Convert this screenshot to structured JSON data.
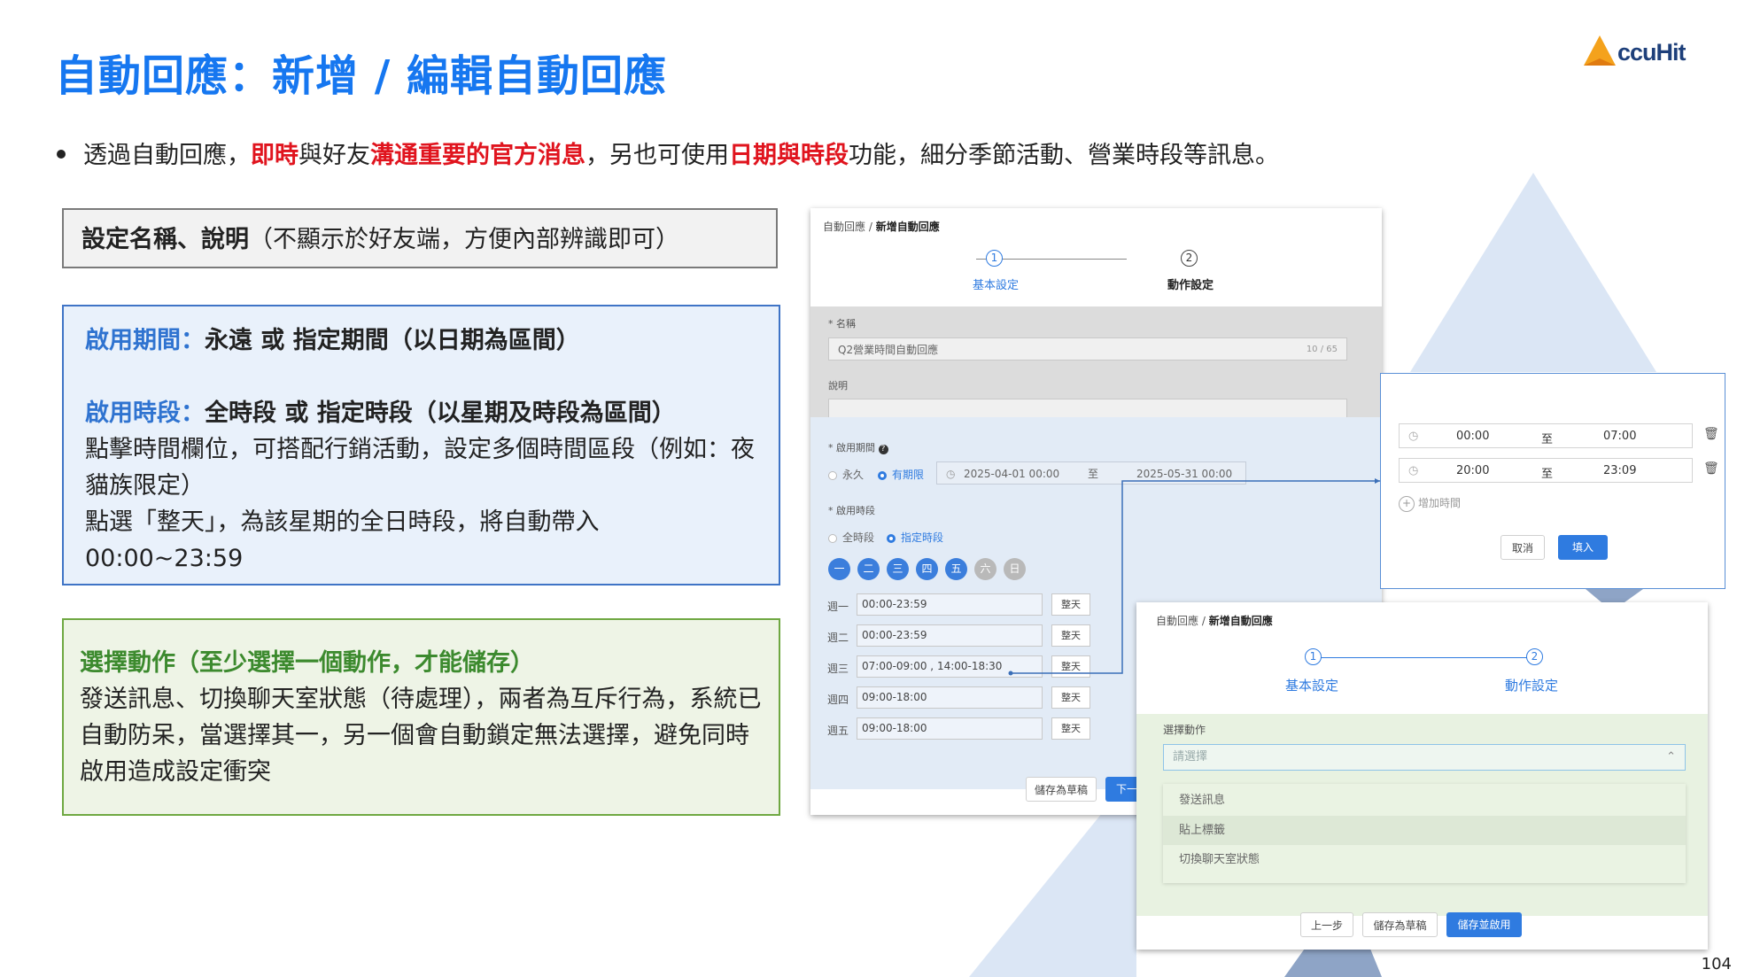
{
  "slide": {
    "title": "自動回應：新增 / 編輯自動回應",
    "logo_text": "ccuHit",
    "page_number": "104",
    "bullet": {
      "p1": "透過自動回應，",
      "r1": "即時",
      "p2": "與好友",
      "r2": "溝通重要的官方消息",
      "p3": "，另也可使用",
      "r3": "日期與時段",
      "p4": "功能，細分季節活動、營業時段等訊息。"
    }
  },
  "box1": {
    "bold": "設定名稱、說明",
    "rest": "（不顯示於好友端，方便內部辨識即可）"
  },
  "box2": {
    "l1_label": "啟用期間：",
    "l1_value": "永遠 或 指定期間（以日期為區間）",
    "l2_label": "啟用時段：",
    "l2_value": "全時段 或 指定時段（以星期及時段為區間）",
    "l3": "點擊時間欄位，可搭配行銷活動，設定多個時間區段（例如：夜貓族限定）",
    "l4": "點選「整天」，為該星期的全日時段，將自動帶入 00:00~23:59"
  },
  "box3": {
    "label": "選擇動作（至少選擇一個動作，才能儲存）",
    "text": "發送訊息、切換聊天室狀態（待處理），兩者為互斥行為，系統已自動防呆，當選擇其一，另一個會自動鎖定無法選擇，避免同時啟用造成設定衝突"
  },
  "shot1": {
    "crumb_root": "自動回應",
    "crumb_sep": "/",
    "crumb_current": "新增自動回應",
    "step1_num": "1",
    "step1_label": "基本設定",
    "step2_num": "2",
    "step2_label": "動作設定",
    "name_label": "* 名稱",
    "name_value": "Q2營業時間自動回應",
    "name_count": "10 / 65",
    "desc_label": "說明",
    "period_label": "* 啟用期間",
    "period_forever": "永久",
    "period_limited": "有期限",
    "date_start": "2025-04-01 00:00",
    "date_to": "至",
    "date_end": "2025-05-31 00:00",
    "slot_label": "* 啟用時段",
    "slot_all": "全時段",
    "slot_specific": "指定時段",
    "days": [
      "一",
      "二",
      "三",
      "四",
      "五",
      "六",
      "日"
    ],
    "weeks": [
      {
        "label": "週一",
        "value": "00:00-23:59",
        "btn": "整天"
      },
      {
        "label": "週二",
        "value": "00:00-23:59",
        "btn": "整天"
      },
      {
        "label": "週三",
        "value": "07:00-09:00 , 14:00-18:30",
        "btn": "整天"
      },
      {
        "label": "週四",
        "value": "09:00-18:00",
        "btn": "整天"
      },
      {
        "label": "週五",
        "value": "09:00-18:00",
        "btn": "整天"
      }
    ],
    "draft_btn": "儲存為草稿",
    "next_btn": "下一"
  },
  "popup": {
    "rows": [
      {
        "start": "00:00",
        "to": "至",
        "end": "07:00"
      },
      {
        "start": "20:00",
        "to": "至",
        "end": "23:09"
      }
    ],
    "add_time": "增加時間",
    "cancel": "取消",
    "fill": "填入"
  },
  "shot2": {
    "crumb_root": "自動回應",
    "crumb_sep": "/",
    "crumb_current": "新增自動回應",
    "step1_num": "1",
    "step1_label": "基本設定",
    "step2_num": "2",
    "step2_label": "動作設定",
    "action_label": "選擇動作",
    "select_placeholder": "請選擇",
    "options": [
      "發送訊息",
      "貼上標籤",
      "切換聊天室狀態"
    ],
    "prev_btn": "上一步",
    "draft_btn": "儲存為草稿",
    "save_btn": "儲存並啟用"
  },
  "colors": {
    "title_blue": "#1677f0",
    "accent_red": "#e0141e",
    "ui_blue": "#2f7be0",
    "green_label": "#3c8a2e"
  }
}
